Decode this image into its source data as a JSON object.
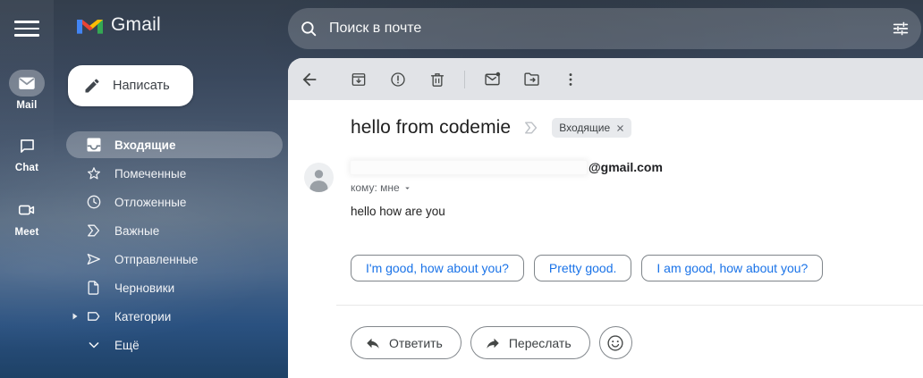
{
  "rail": {
    "items": [
      {
        "label": "Mail",
        "active": true
      },
      {
        "label": "Chat",
        "active": false
      },
      {
        "label": "Meet",
        "active": false
      }
    ]
  },
  "sidebar": {
    "brand": "Gmail",
    "compose_label": "Написать",
    "items": [
      {
        "label": "Входящие",
        "selected": true
      },
      {
        "label": "Помеченные"
      },
      {
        "label": "Отложенные"
      },
      {
        "label": "Важные"
      },
      {
        "label": "Отправленные"
      },
      {
        "label": "Черновики"
      },
      {
        "label": "Категории",
        "expandable": true
      },
      {
        "label": "Ещё"
      }
    ]
  },
  "search": {
    "placeholder": "Поиск в почте"
  },
  "email": {
    "subject": "hello from codemie",
    "label_chip": "Входящие",
    "sender_domain": "@gmail.com",
    "recipient_line": "кому: мне",
    "body": "hello how are you",
    "smart_replies": [
      "I'm good, how about you?",
      "Pretty good.",
      "I am good, how about you?"
    ],
    "reply_label": "Ответить",
    "forward_label": "Переслать"
  },
  "colors": {
    "accent_blue": "#1a73e8",
    "logo_red": "#ea4335",
    "logo_blue": "#4285f4",
    "logo_green": "#34a853",
    "logo_yellow": "#fbbc04"
  },
  "icons": [
    "hamburger-icon",
    "mail-icon",
    "chat-icon",
    "meet-icon",
    "pencil-icon",
    "inbox-icon",
    "star-icon",
    "clock-icon",
    "important-icon",
    "send-icon",
    "draft-icon",
    "label-icon",
    "chevron-down-icon",
    "search-icon",
    "tune-icon",
    "back-icon",
    "archive-icon",
    "report-spam-icon",
    "delete-icon",
    "mark-unread-icon",
    "move-to-icon",
    "more-vert-icon",
    "person-icon",
    "close-icon",
    "dropdown-arrow-icon",
    "reply-icon",
    "forward-icon",
    "emoji-icon"
  ]
}
